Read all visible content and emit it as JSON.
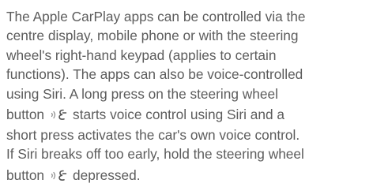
{
  "paragraph": {
    "lines": [
      "The Apple CarPlay apps can be controlled via the",
      "centre display, mobile phone or with the steering",
      "wheel's right-hand keypad (applies to certain",
      "functions). The apps can also be voice-controlled",
      "using Siri. A long press on the steering wheel"
    ],
    "line6_before_icon": "button",
    "line6_after_icon": "starts voice control using Siri and a",
    "line7": "short press activates the car's own voice control.",
    "line8": "If Siri breaks off too early, hold the steering wheel",
    "line9_before_icon": "button",
    "line9_after_icon": "depressed."
  },
  "icons": {
    "voice_control": "voice-control-icon"
  }
}
